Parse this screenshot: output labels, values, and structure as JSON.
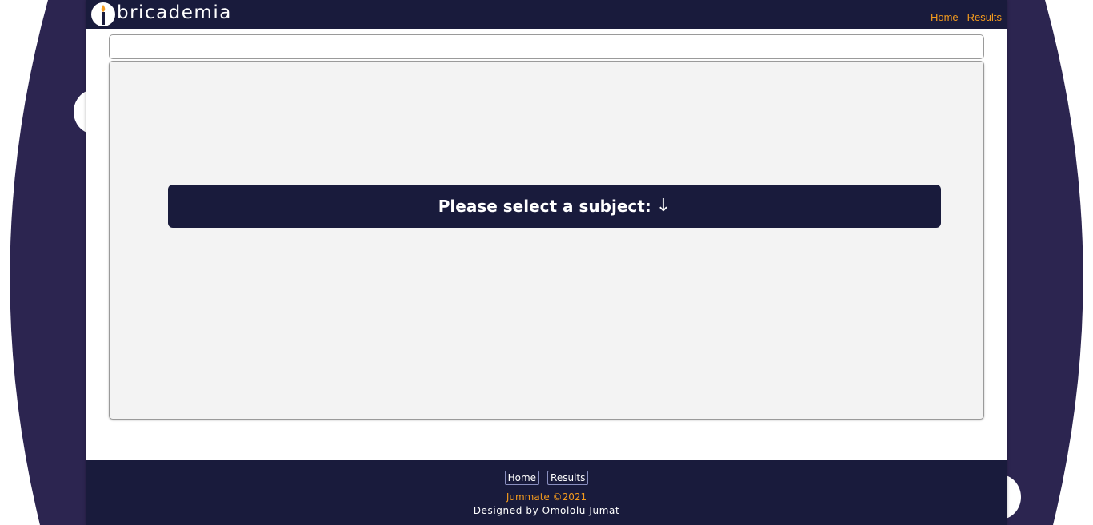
{
  "brand": {
    "name": "bricademia"
  },
  "header_nav": [
    {
      "label": "Home"
    },
    {
      "label": "Results"
    }
  ],
  "main": {
    "prompt": "Please select a subject:",
    "prompt_arrow": "↓"
  },
  "footer": {
    "nav": [
      {
        "label": "Home"
      },
      {
        "label": "Results"
      }
    ],
    "copyright": "Jummate ©2021",
    "credit": "Designed by Omololu Jumat"
  },
  "colors": {
    "navy": "#191b3c",
    "accent_orange": "#f39a1d",
    "background_purple": "#2c2550",
    "panel_grey": "#f3f3f3"
  }
}
